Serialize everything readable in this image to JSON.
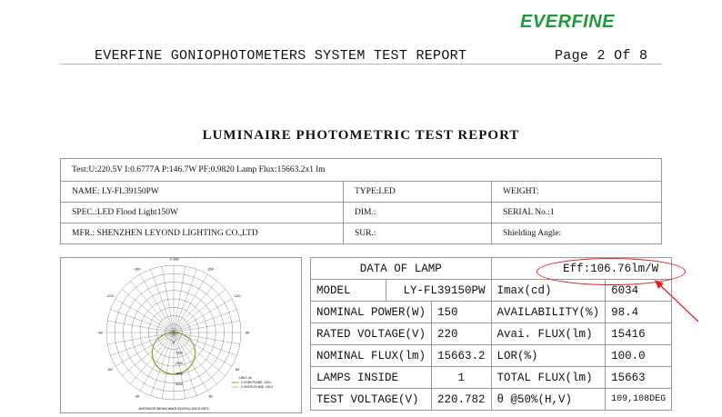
{
  "logo": "EVERFINE",
  "header": {
    "left": "EVERFINE GONIOPHOTOMETERS SYSTEM TEST REPORT",
    "right": "Page 2 Of 8"
  },
  "title": "LUMINAIRE PHOTOMETRIC TEST REPORT",
  "info": {
    "test_line": "Test:U:220.5V I:0.6777A P:146.7W PF:0.9820  Lamp Flux:15663.2x1 lm",
    "name": "NAME: LY-FL39150PW",
    "type": "TYPE:LED",
    "weight": "WEIGHT:",
    "spec": "SPEC.:LED Flood Light150W",
    "dim": "DIM.:",
    "serial": "SERIAL No.:1",
    "mfr": "MFR.: SHENZHEN LEYOND LIGHTING CO.,LTD",
    "sur": "SUR.:",
    "shielding": "Shielding Angle:"
  },
  "polar": {
    "angle_labels": [
      "-/+180",
      "-150",
      "150",
      "-120",
      "120",
      "-90",
      "90",
      "-60",
      "60",
      "-30",
      "30",
      "0"
    ],
    "radial_labels": [
      "1300",
      "2600",
      "3900",
      "5200"
    ],
    "legend_title": "UNIT: cd",
    "legend": [
      "C 0/180 PLANE, 100.0",
      "C 90/270 PLANE, 100.0"
    ],
    "caption": "AVERAGE BEAM ANGLE(50%):108.5 DEG",
    "colors": {
      "c0": "#6b8e23",
      "c90": "#c8b400",
      "grid": "#555555"
    }
  },
  "data_table": {
    "header_left": "DATA OF LAMP",
    "eff": "Eff:106.76lm/W",
    "model_label": "MODEL",
    "model_value": "LY-FL39150PW",
    "rows": [
      {
        "l1": "NOMINAL POWER(W)",
        "v1": "150",
        "l2": "AVAILABILITY(%)",
        "v2": "98.4"
      },
      {
        "l1": "RATED VOLTAGE(V)",
        "v1": "220",
        "l2": "Avai. FLUX(lm)",
        "v2": "15416"
      },
      {
        "l1": "NOMINAL FLUX(lm)",
        "v1": "15663.2",
        "l2": "LOR(%)",
        "v2": "100.0"
      },
      {
        "l1": "LAMPS INSIDE",
        "v1": "1",
        "l2": "TOTAL FLUX(lm)",
        "v2": "15663"
      },
      {
        "l1": "TEST VOLTAGE(V)",
        "v1": "220.782",
        "l2": "θ @50%(H,V)",
        "v2": "109,108DEG"
      }
    ],
    "imax_label": "Imax(cd)",
    "imax_value": "6034"
  },
  "annotation_color": "#e02020"
}
